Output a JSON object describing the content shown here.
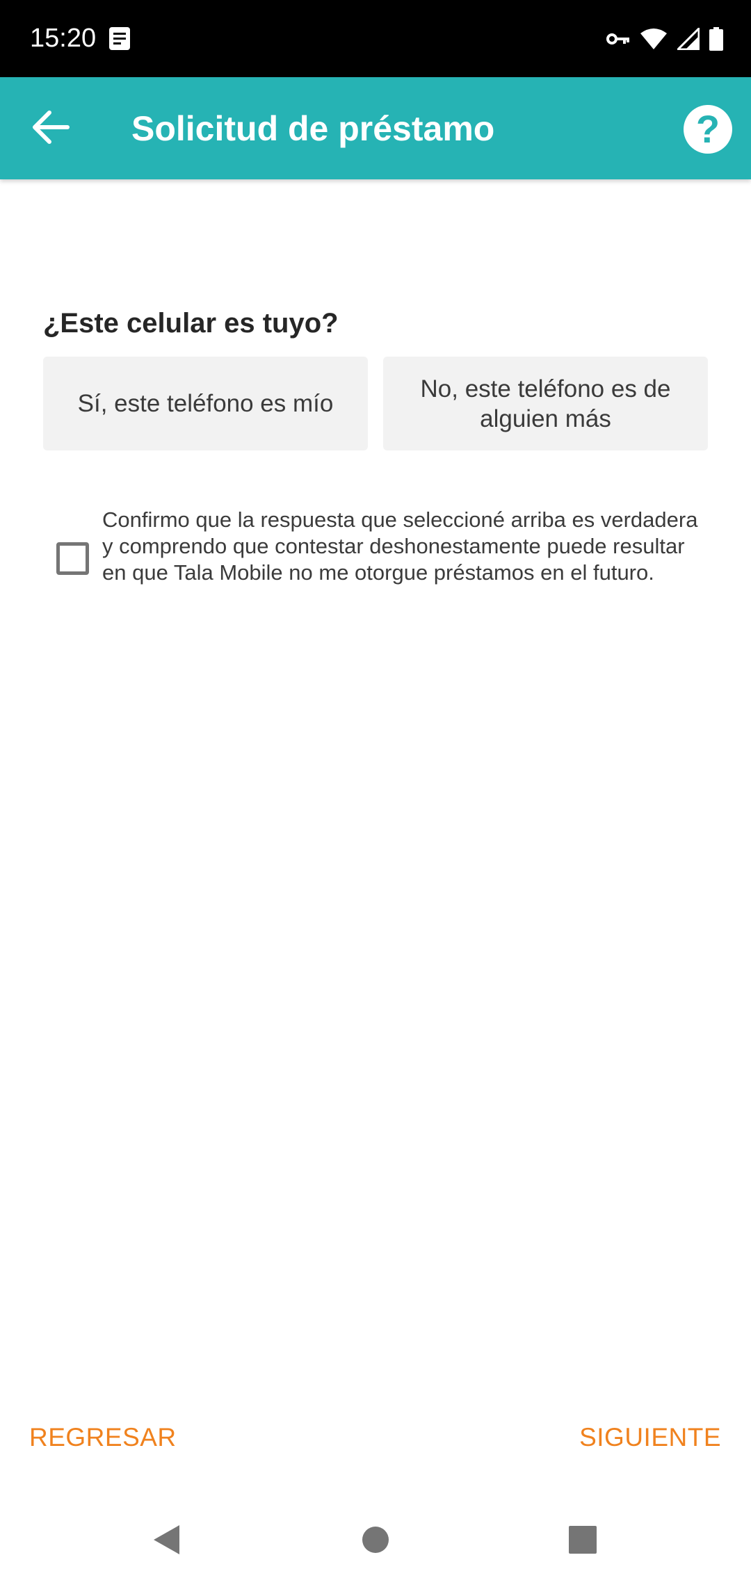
{
  "status_bar": {
    "time": "15:20",
    "icons": [
      "notification-doc-icon",
      "vpn-key-icon",
      "wifi-icon",
      "signal-icon",
      "battery-icon"
    ]
  },
  "app_bar": {
    "title": "Solicitud de préstamo",
    "back_icon": "arrow-left-icon",
    "help_label": "?",
    "color": "#26b3b4"
  },
  "form": {
    "question": "¿Este celular es tuyo?",
    "options": [
      {
        "label": "Sí, este teléfono es mío"
      },
      {
        "label": "No, este teléfono es de alguien más"
      }
    ],
    "confirm_checked": false,
    "confirm_text": "Confirmo que la respuesta que seleccioné arriba es verdadera y comprendo que contestar deshonestamente puede resultar en que Tala Mobile no me otorgue préstamos en el futuro."
  },
  "footer": {
    "back_label": "REGRESAR",
    "next_label": "SIGUIENTE",
    "accent_color": "#f0821e"
  },
  "nav_bar": {
    "icons": [
      "nav-back-icon",
      "nav-home-icon",
      "nav-recent-icon"
    ]
  }
}
